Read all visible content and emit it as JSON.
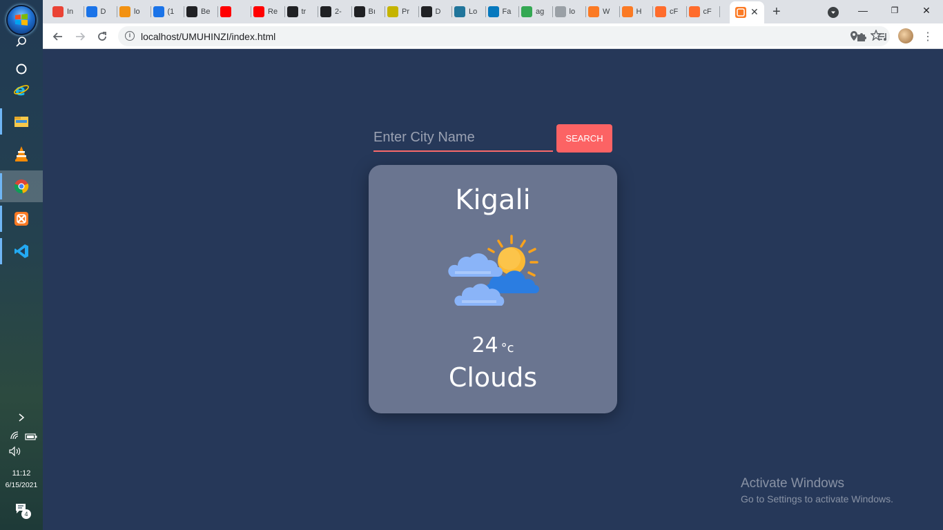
{
  "taskbar": {
    "time": "11:12",
    "date": "6/15/2021",
    "notification_count": "4"
  },
  "browser": {
    "tabs": [
      {
        "label": "In",
        "icon": "gmail-icon",
        "color": "#ea4335"
      },
      {
        "label": "D",
        "icon": "download-icon",
        "color": "#1a73e8"
      },
      {
        "label": "lo",
        "icon": "phpmyadmin-icon",
        "color": "#f29111"
      },
      {
        "label": "(1",
        "icon": "skype-icon",
        "color": "#1a73e8"
      },
      {
        "label": "Be",
        "icon": "github-icon",
        "color": "#202124"
      },
      {
        "label": "",
        "icon": "youtube-icon",
        "color": "#ff0000"
      },
      {
        "label": "Re",
        "icon": "youtube-icon",
        "color": "#ff0000"
      },
      {
        "label": "tr",
        "icon": "github-icon",
        "color": "#202124"
      },
      {
        "label": "2-",
        "icon": "codepen-icon",
        "color": "#202124"
      },
      {
        "label": "Bı",
        "icon": "github-icon",
        "color": "#202124"
      },
      {
        "label": "Pr",
        "icon": "wave-icon",
        "color": "#c5b400"
      },
      {
        "label": "D",
        "icon": "github-icon",
        "color": "#202124"
      },
      {
        "label": "Lo",
        "icon": "wordpress-icon",
        "color": "#21759b"
      },
      {
        "label": "Fa",
        "icon": "drupal-icon",
        "color": "#0678be"
      },
      {
        "label": "ag",
        "icon": "drive-icon",
        "color": "#34a853"
      },
      {
        "label": "lo",
        "icon": "xampp-icon",
        "color": "#9aa0a6"
      },
      {
        "label": "W",
        "icon": "xampp-icon",
        "color": "#fb7a24"
      },
      {
        "label": "H",
        "icon": "xampp-icon",
        "color": "#fb7a24"
      },
      {
        "label": "cF",
        "icon": "cpanel-icon",
        "color": "#ff6c2c"
      },
      {
        "label": "cF",
        "icon": "cpanel-icon",
        "color": "#ff6c2c"
      }
    ],
    "url": "localhost/UMUHINZI/index.html"
  },
  "app": {
    "search_placeholder": "Enter City Name",
    "search_value": "",
    "search_button": "SEARCH",
    "city": "Kigali",
    "temperature": "24",
    "unit": "°c",
    "condition": "Clouds",
    "weather_icon": "sun-behind-clouds-icon",
    "accent_color": "#fc6364",
    "background_color": "#263859",
    "card_color": "#6a7590"
  },
  "watermark": {
    "title": "Activate Windows",
    "subtitle": "Go to Settings to activate Windows."
  }
}
